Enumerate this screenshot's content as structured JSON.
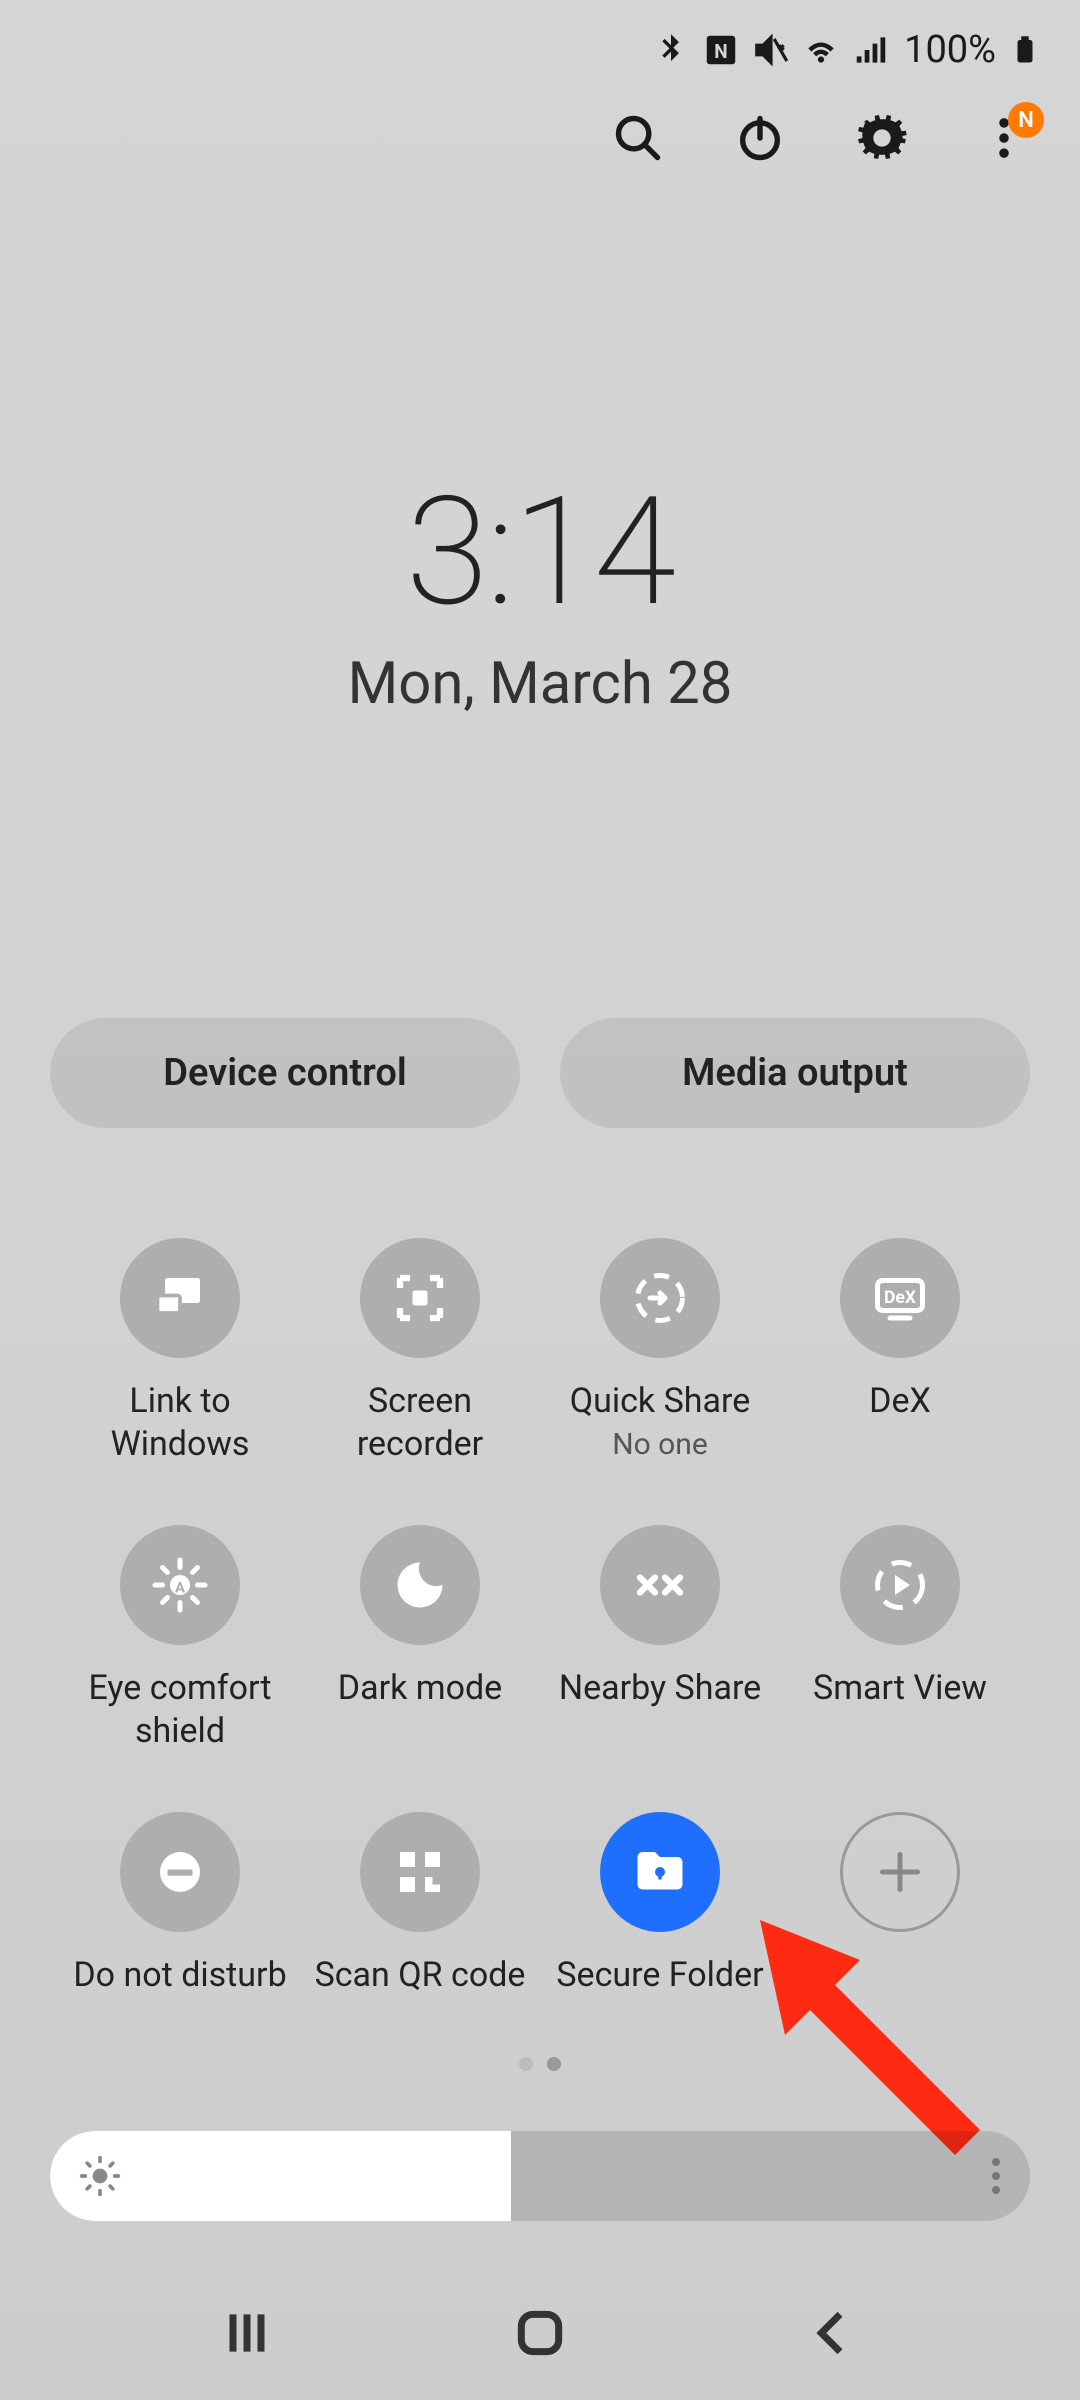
{
  "status": {
    "battery_pct": "100%",
    "badge_letter": "N"
  },
  "clock": {
    "time": "3:14",
    "date": "Mon, March 28"
  },
  "pills": {
    "device_control": "Device control",
    "media_output": "Media output"
  },
  "tiles": [
    {
      "label": "Link to Windows",
      "sub": ""
    },
    {
      "label": "Screen recorder",
      "sub": ""
    },
    {
      "label": "Quick Share",
      "sub": "No one"
    },
    {
      "label": "DeX",
      "sub": ""
    },
    {
      "label": "Eye comfort shield",
      "sub": ""
    },
    {
      "label": "Dark mode",
      "sub": ""
    },
    {
      "label": "Nearby Share",
      "sub": ""
    },
    {
      "label": "Smart View",
      "sub": ""
    },
    {
      "label": "Do not disturb",
      "sub": ""
    },
    {
      "label": "Scan QR code",
      "sub": ""
    },
    {
      "label": "Secure Folder",
      "sub": ""
    },
    {
      "label": "",
      "sub": ""
    }
  ],
  "colors": {
    "active_tile": "#1f6fff",
    "badge": "#ff7a00",
    "arrow": "#ff2a12"
  }
}
